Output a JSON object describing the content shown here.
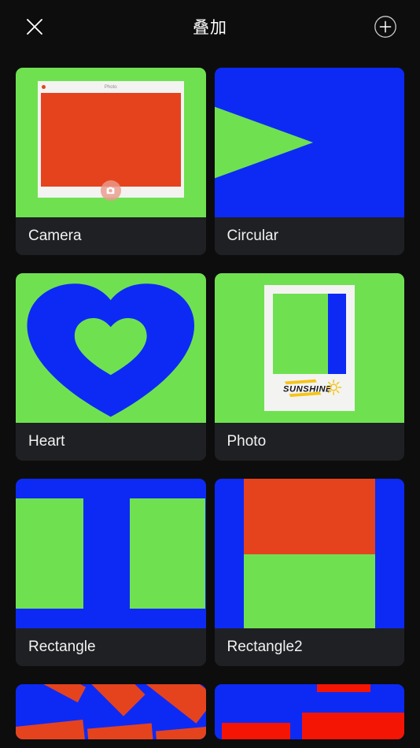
{
  "header": {
    "title": "叠加",
    "close_icon": "close-x-icon",
    "add_icon": "plus-circle-icon"
  },
  "theme": {
    "page_bg": "#0d0d0d",
    "card_bg": "#1e2023",
    "label_text": "#f2f2f2",
    "title_text": "#ffffff",
    "green": "#6fe150",
    "blue": "#0d2af5",
    "orange": "#e5431e",
    "red": "#f51505",
    "white": "#f3f3f1",
    "yellow": "#f5c518"
  },
  "grid": {
    "items": [
      {
        "label": "Camera",
        "art": "camera",
        "window_title": "Photo",
        "shutter_icon": "camera-icon"
      },
      {
        "label": "Circular",
        "art": "circular"
      },
      {
        "label": "Heart",
        "art": "heart"
      },
      {
        "label": "Photo",
        "art": "photo",
        "caption": "SUNSHINE",
        "sun_icon": "sun-doodle-icon"
      },
      {
        "label": "Rectangle",
        "art": "rectangle"
      },
      {
        "label": "Rectangle2",
        "art": "rectangle2"
      }
    ],
    "partial_items": [
      {
        "art": "confetti"
      },
      {
        "art": "blocks"
      }
    ]
  }
}
